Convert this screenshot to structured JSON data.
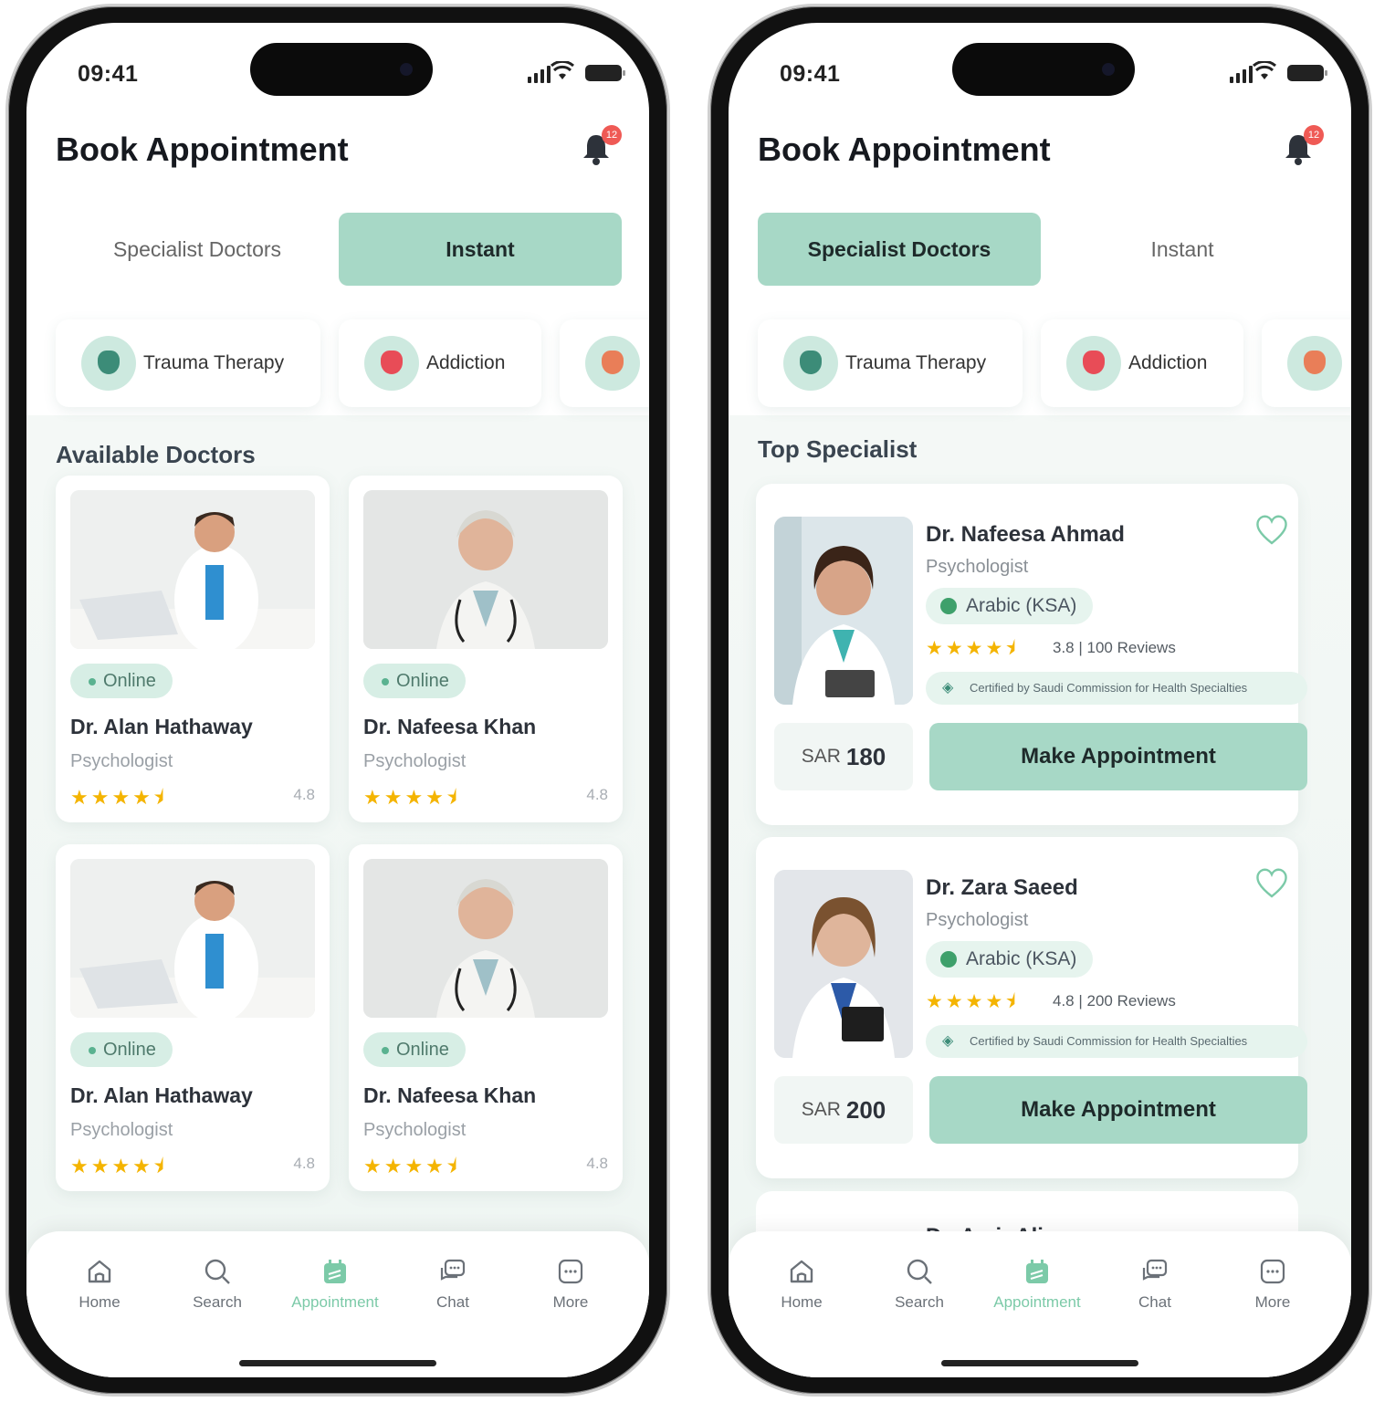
{
  "status": {
    "time": "09:41"
  },
  "header": {
    "title": "Book Appointment",
    "notifications": "12"
  },
  "tabs": [
    "Specialist Doctors",
    "Instant"
  ],
  "categories": [
    "Trauma Therapy",
    "Addiction"
  ],
  "left": {
    "section_title": "Available Doctors",
    "doctors": [
      {
        "status": "Online",
        "name": "Dr. Alan Hathaway",
        "specialty": "Psychologist",
        "stars": "★★★★⯨",
        "rating": "4.8"
      },
      {
        "status": "Online",
        "name": "Dr. Nafeesa Khan",
        "specialty": "Psychologist",
        "stars": "★★★★⯨",
        "rating": "4.8"
      },
      {
        "status": "Online",
        "name": "Dr. Alan Hathaway",
        "specialty": "Psychologist",
        "stars": "★★★★⯨",
        "rating": "4.8"
      },
      {
        "status": "Online",
        "name": "Dr. Nafeesa Khan",
        "specialty": "Psychologist",
        "stars": "★★★★⯨",
        "rating": "4.8"
      }
    ]
  },
  "right": {
    "section_title": "Top Specialist",
    "specialists": [
      {
        "name": "Dr. Nafeesa Ahmad",
        "specialty": "Psychologist",
        "language": "Arabic (KSA)",
        "stars": "★★★★⯨",
        "reviews": "3.8 | 100 Reviews",
        "certification": "Certified by Saudi Commission for Health Specialties",
        "currency": "SAR",
        "price": "180",
        "cta": "Make Appointment"
      },
      {
        "name": "Dr. Zara Saeed",
        "specialty": "Psychologist",
        "language": "Arabic (KSA)",
        "stars": "★★★★⯨",
        "reviews": "4.8 | 200 Reviews",
        "certification": "Certified by Saudi Commission for Health Specialties",
        "currency": "SAR",
        "price": "200",
        "cta": "Make Appointment"
      }
    ],
    "peek_name": "Dr. Amir Ali"
  },
  "nav": [
    "Home",
    "Search",
    "Appointment",
    "Chat",
    "More"
  ],
  "colors": {
    "accent": "#a7d8c6",
    "active_nav": "#7ccaa8",
    "star": "#f4b400",
    "badge": "#ef5a55"
  }
}
